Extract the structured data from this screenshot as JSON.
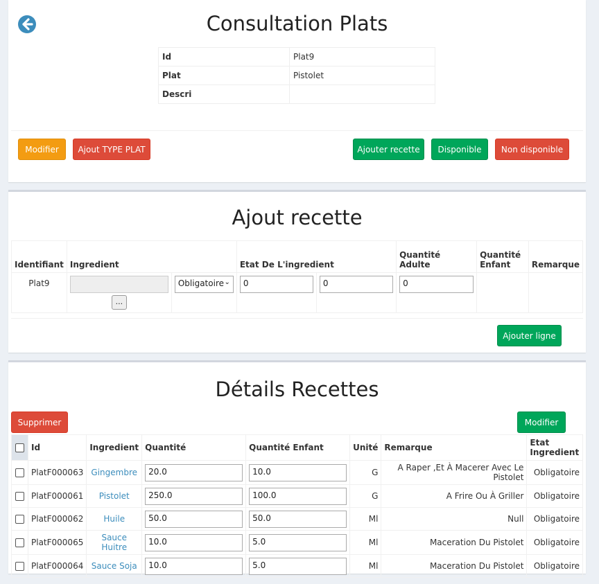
{
  "consultation": {
    "title": "Consultation Plats",
    "rows": [
      {
        "label": "Id",
        "value": "Plat9"
      },
      {
        "label": "Plat",
        "value": "Pistolet"
      },
      {
        "label": "Descri",
        "value": ""
      }
    ],
    "buttons": {
      "modifier": "Modifier",
      "ajout_type_plat": "Ajout TYPE PLAT",
      "ajouter_recette": "Ajouter recette",
      "disponible": "Disponible",
      "non_disponible": "Non disponible"
    }
  },
  "ajout_recette": {
    "title": "Ajout recette",
    "headers": {
      "identifiant": "Identifiant",
      "ingredient": "Ingredient",
      "etat": "Etat De L'ingredient",
      "qte_adulte": "Quantité Adulte",
      "qte_enfant": "Quantité Enfant",
      "remarque": "Remarque"
    },
    "row": {
      "identifiant": "Plat9",
      "browse": "...",
      "select": "Obligatoire",
      "v1": "0",
      "v2": "0",
      "v3": "0"
    },
    "add_line": "Ajouter ligne"
  },
  "details": {
    "title": "Détails Recettes",
    "supprimer": "Supprimer",
    "modifier": "Modifier",
    "headers": {
      "id": "Id",
      "ingredient": "Ingredient",
      "quantite": "Quantité",
      "quantite_enfant": "Quantité Enfant",
      "unite": "Unité",
      "remarque": "Remarque",
      "etat": "Etat Ingredient"
    },
    "rows": [
      {
        "id": "PlatF000063",
        "ingredient": "Gingembre",
        "quantite": "20.0",
        "enfant": "10.0",
        "unite": "G",
        "remarque": "A Raper ,Et À Macerer Avec Le Pistolet",
        "etat": "Obligatoire"
      },
      {
        "id": "PlatF000061",
        "ingredient": "Pistolet",
        "quantite": "250.0",
        "enfant": "100.0",
        "unite": "G",
        "remarque": "A Frire Ou À Griller",
        "etat": "Obligatoire"
      },
      {
        "id": "PlatF000062",
        "ingredient": "Huile",
        "quantite": "50.0",
        "enfant": "50.0",
        "unite": "Ml",
        "remarque": "Null",
        "etat": "Obligatoire"
      },
      {
        "id": "PlatF000065",
        "ingredient": "Sauce Huitre",
        "quantite": "10.0",
        "enfant": "5.0",
        "unite": "Ml",
        "remarque": "Maceration Du Pistolet",
        "etat": "Obligatoire"
      },
      {
        "id": "PlatF000064",
        "ingredient": "Sauce Soja",
        "quantite": "10.0",
        "enfant": "5.0",
        "unite": "Ml",
        "remarque": "Maceration Du Pistolet",
        "etat": "Obligatoire"
      }
    ]
  }
}
